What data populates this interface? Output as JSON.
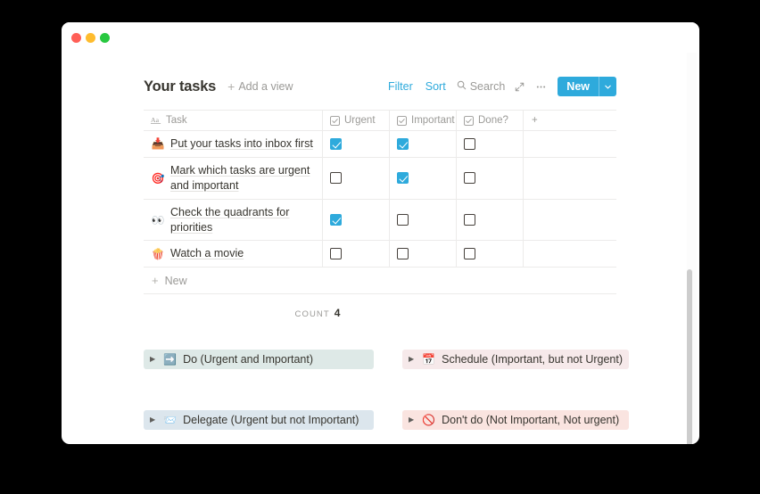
{
  "window": {
    "traffic_lights": [
      {
        "name": "close",
        "color": "#ff5f57"
      },
      {
        "name": "minimize",
        "color": "#febc2e"
      },
      {
        "name": "maximize",
        "color": "#28c840"
      }
    ]
  },
  "header": {
    "title": "Your tasks",
    "add_view_label": "Add a view",
    "add_view_plus": "+"
  },
  "toolbar": {
    "filter_label": "Filter",
    "sort_label": "Sort",
    "search_label": "Search",
    "expand_icon": "expand-icon",
    "more_icon": "…",
    "new_label": "New",
    "new_dropdown_icon": "chevron-down-icon",
    "accent_color": "#2eaadc"
  },
  "table": {
    "columns": [
      {
        "label": "Task",
        "icon": "text-aa-icon",
        "type": "title"
      },
      {
        "label": "Urgent",
        "icon": "checkbox-icon",
        "type": "checkbox"
      },
      {
        "label": "Important",
        "icon": "checkbox-icon",
        "type": "checkbox"
      },
      {
        "label": "Done?",
        "icon": "checkbox-icon",
        "type": "checkbox"
      }
    ],
    "add_column_icon": "+",
    "rows": [
      {
        "emoji": "📥",
        "emoji_name": "inbox-tray-emoji",
        "title": "Put your tasks into inbox first",
        "urgent": true,
        "important": true,
        "done": false
      },
      {
        "emoji": "🎯",
        "emoji_name": "dart-emoji",
        "title": "Mark which tasks are urgent and important",
        "urgent": false,
        "important": true,
        "done": false
      },
      {
        "emoji": "👀",
        "emoji_name": "eyes-emoji",
        "title": "Check the quadrants for priorities",
        "urgent": true,
        "important": false,
        "done": false
      },
      {
        "emoji": "🍿",
        "emoji_name": "popcorn-emoji",
        "title": "Watch a movie",
        "urgent": false,
        "important": false,
        "done": false
      }
    ],
    "new_row_label": "New",
    "new_row_plus": "+",
    "count_label": "Count",
    "count_value": "4"
  },
  "quadrants": [
    {
      "id": "do",
      "emoji": "➡️",
      "emoji_name": "right-arrow-emoji",
      "label": "Do (Urgent and Important)",
      "bg_color": "#dee9e7",
      "arrow": "▶"
    },
    {
      "id": "schedule",
      "emoji": "📅",
      "emoji_name": "calendar-emoji",
      "label": "Schedule (Important, but not Urgent)",
      "bg_color": "#f6e9ea",
      "arrow": "▶"
    },
    {
      "id": "delegate",
      "emoji": "📨",
      "emoji_name": "incoming-envelope-emoji",
      "label": "Delegate (Urgent but not Important)",
      "bg_color": "#dce6ed",
      "arrow": "▶"
    },
    {
      "id": "dont-do",
      "emoji": "🚫",
      "emoji_name": "prohibited-emoji",
      "label": "Don't do (Not Important, Not urgent)",
      "bg_color": "#fae4e0",
      "arrow": "▶"
    }
  ]
}
